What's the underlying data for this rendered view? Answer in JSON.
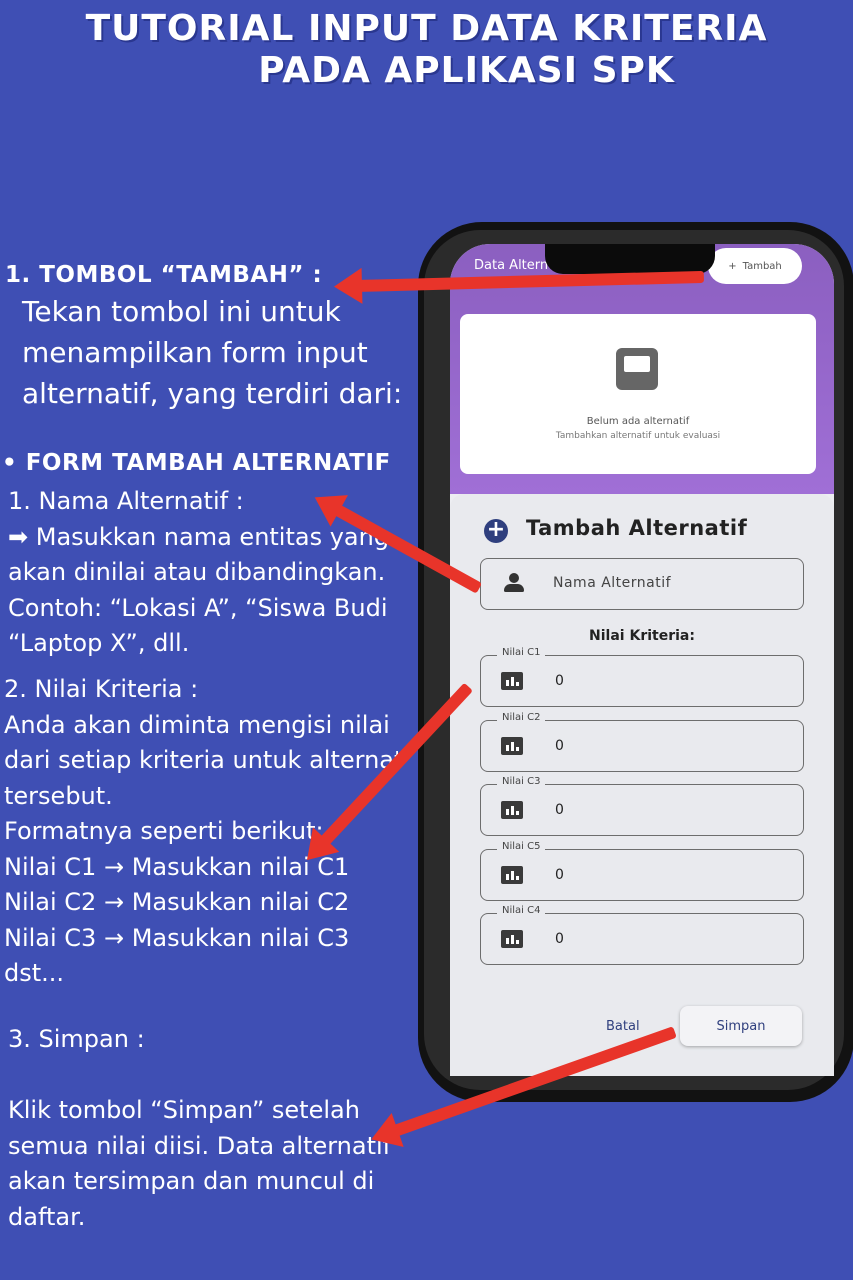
{
  "header": {
    "line1": "TUTORIAL INPUT DATA KRITERIA",
    "line2": "PADA APLIKASI SPK"
  },
  "tutorial": {
    "step1_heading": "1. TOMBOL “TAMBAH” :",
    "step1_lines": [
      "Tekan tombol ini untuk",
      "menampilkan form input",
      "alternatif, yang terdiri dari:"
    ],
    "form_heading": "• FORM TAMBAH ALTERNATIF",
    "nama_lines": [
      "1.  Nama Alternatif :",
      "➡ Masukkan nama entitas yang",
      "akan dinilai atau dibandingkan.",
      "Contoh: “Lokasi A”, “Siswa Budi”,",
      " “Laptop X”, dll."
    ],
    "nilai_lines": [
      "2. Nilai Kriteria :",
      "Anda akan diminta mengisi nilai",
      "dari setiap kriteria untuk alternatif",
      "tersebut.",
      "Formatnya seperti berikut:",
      "Nilai C1 → Masukkan nilai  C1",
      "Nilai C2 → Masukkan nilai  C2",
      "Nilai C3 → Masukkan nilai  C3",
      "dst..."
    ],
    "simpan_heading": "3. Simpan :",
    "simpan_lines": [
      "Klik tombol “Simpan” setelah",
      "semua nilai diisi. Data alternatif",
      "akan tersimpan dan muncul di",
      " daftar."
    ]
  },
  "app": {
    "appbar_title": "Data Altern",
    "tambah_label": "Tambah",
    "empty_title": "Belum ada alternatif",
    "empty_subtitle": "Tambahkan alternatif untuk evaluasi",
    "sheet_title": "Tambah Alternatif",
    "nama_placeholder": "Nama Alternatif",
    "nilai_kriteria_label": "Nilai Kriteria:",
    "criteria": [
      {
        "label": "Nilai C1",
        "value": "0"
      },
      {
        "label": "Nilai C2",
        "value": "0"
      },
      {
        "label": "Nilai C3",
        "value": "0"
      },
      {
        "label": "Nilai C5",
        "value": "0"
      },
      {
        "label": "Nilai C4",
        "value": "0"
      }
    ],
    "batal_label": "Batal",
    "simpan_label": "Simpan"
  },
  "colors": {
    "background": "#3f4fb4",
    "arrow": "#e8342a",
    "accent": "#2f3f7e"
  }
}
